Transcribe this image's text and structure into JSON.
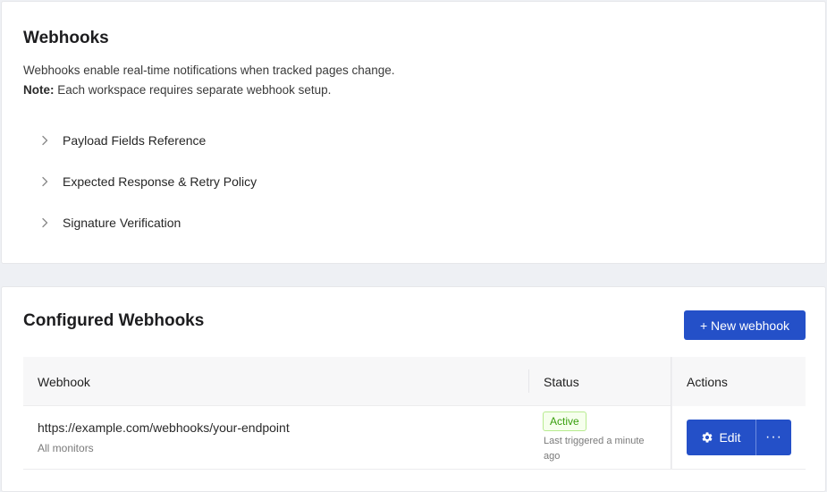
{
  "intro": {
    "title": "Webhooks",
    "description": "Webhooks enable real-time notifications when tracked pages change.",
    "note_label": "Note:",
    "note_text": " Each workspace requires separate webhook setup.",
    "sections": [
      {
        "label": "Payload Fields Reference",
        "icon": "chevron-right-icon"
      },
      {
        "label": "Expected Response & Retry Policy",
        "icon": "chevron-right-icon"
      },
      {
        "label": "Signature Verification",
        "icon": "chevron-right-icon"
      }
    ]
  },
  "configured": {
    "title": "Configured Webhooks",
    "new_button_label": "+ New webhook",
    "columns": {
      "webhook": "Webhook",
      "status": "Status",
      "actions": "Actions"
    },
    "rows": [
      {
        "url": "https://example.com/webhooks/your-endpoint",
        "scope": "All monitors",
        "status": "Active",
        "last_triggered": "Last triggered a minute ago",
        "edit_label": "Edit",
        "edit_icon": "gear-icon",
        "more_label": "···"
      }
    ]
  },
  "colors": {
    "primary": "#2450c8",
    "status_active_text": "#389e0d",
    "status_active_bg": "#f6ffed",
    "status_active_border": "#b7eb8f",
    "page_bg": "#eef0f4"
  }
}
